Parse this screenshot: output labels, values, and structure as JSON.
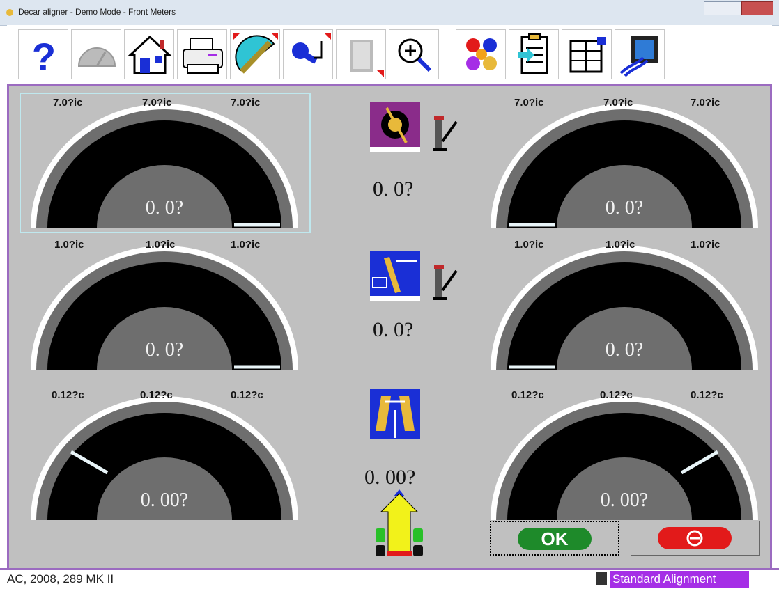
{
  "window": {
    "title": "Decar aligner - Demo Mode  -  Front Meters"
  },
  "toolbar": {
    "buttons": [
      {
        "icon": "help-icon"
      },
      {
        "icon": "gauge-icon"
      },
      {
        "icon": "home-icon"
      },
      {
        "icon": "printer-icon"
      },
      {
        "icon": "protractor-icon"
      },
      {
        "icon": "wrench-icon"
      },
      {
        "icon": "film-icon"
      },
      {
        "icon": "zoom-in-icon"
      },
      {
        "icon": "molecule-icon"
      },
      {
        "icon": "clipboard-icon"
      },
      {
        "icon": "table-icon"
      },
      {
        "icon": "equipment-icon"
      }
    ]
  },
  "meters": {
    "top_left": {
      "labels": [
        "7.0?ic",
        "7.0?ic",
        "7.0?ic"
      ],
      "value": "0. 0?"
    },
    "top_right": {
      "labels": [
        "7.0?ic",
        "7.0?ic",
        "7.0?ic"
      ],
      "value": "0. 0?"
    },
    "mid_left": {
      "labels": [
        "1.0?ic",
        "1.0?ic",
        "1.0?ic"
      ],
      "value": "0. 0?"
    },
    "mid_right": {
      "labels": [
        "1.0?ic",
        "1.0?ic",
        "1.0?ic"
      ],
      "value": "0. 0?"
    },
    "bot_left": {
      "labels": [
        "0.12?c",
        "0.12?c",
        "0.12?c"
      ],
      "value": "0. 00?"
    },
    "bot_right": {
      "labels": [
        "0.12?c",
        "0.12?c",
        "0.12?c"
      ],
      "value": "0. 00?"
    }
  },
  "center": {
    "caster_value": "0. 0?",
    "sai_value": "0. 0?",
    "setback_value": "0. 00?"
  },
  "buttons": {
    "ok_label": "OK"
  },
  "status": {
    "vehicle": "AC, 2008, 289 MK II",
    "mode": "Standard Alignment"
  }
}
